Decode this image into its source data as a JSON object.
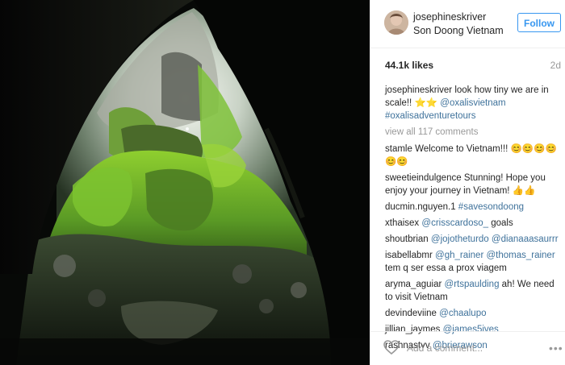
{
  "header": {
    "username": "josephineskriver",
    "location": "Son Doong Vietnam",
    "follow_label": "Follow"
  },
  "meta": {
    "likes": "44.1k likes",
    "age": "2d"
  },
  "caption": {
    "username": "josephineskriver",
    "text": "look how tiny we are in scale!! ",
    "emoji": "⭐⭐",
    "mentions": "@oxalisvietnam #oxalisadventuretours"
  },
  "view_all": "view all 117 comments",
  "comments": [
    {
      "user": "stamle",
      "text": "Welcome to Vietnam!!! 😊😊😊😊😊😊"
    },
    {
      "user": "sweetieindulgence",
      "text": "Stunning! Hope you enjoy your journey in Vietnam! 👍👍"
    },
    {
      "user": "ducmin.nguyen.1",
      "link": "#savesondoong"
    },
    {
      "user": "xthaisex",
      "link": "@crisscardoso_",
      "text": " goals"
    },
    {
      "user": "shoutbrian",
      "link": "@jojotheturdo @dianaaasaurrr"
    },
    {
      "user": "isabellabmr",
      "link": "@gh_rainer @thomas_rainer",
      "text": " tem q ser essa a prox viagem"
    },
    {
      "user": "aryma_aguiar",
      "link": "@rtspaulding",
      "text": " ah! We need to visit Vietnam"
    },
    {
      "user": "devindeviine",
      "link": "@chaalupo"
    },
    {
      "user": "jillian_jaymes",
      "link": "@james5ives"
    },
    {
      "user": "rashnastvv",
      "link": "@brierawson"
    }
  ],
  "footer": {
    "add_comment_placeholder": "Add a comment...",
    "heart_icon": "heart-icon",
    "more_icon": "more-options-icon"
  },
  "colors": {
    "link": "#3f729b",
    "follow": "#3897f0",
    "muted": "#999999"
  }
}
